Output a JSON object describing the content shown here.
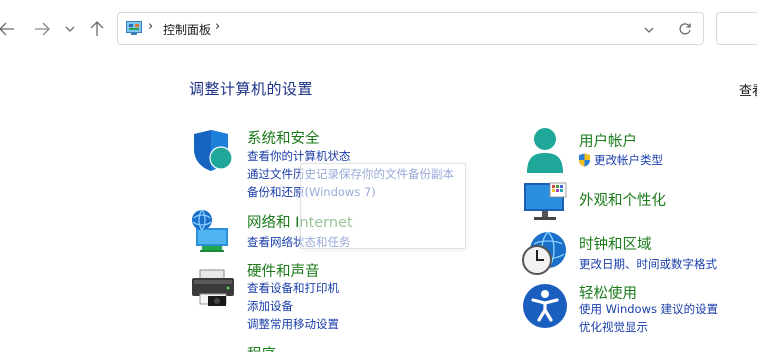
{
  "nav": {
    "back_icon": "arrow-left-icon",
    "forward_icon": "arrow-right-icon",
    "recent_icon": "chevron-down-icon",
    "up_icon": "arrow-up-icon"
  },
  "address": {
    "breadcrumb": "控制面板",
    "separator": "›",
    "dropdown_icon": "chevron-down-icon",
    "refresh_icon": "refresh-icon"
  },
  "main": {
    "title": "调整计算机的设置",
    "view_by": "查看",
    "categories": [
      {
        "icon": "shield-icon",
        "heading": "系统和安全",
        "links": [
          "查看你的计算机状态",
          "通过文件历史记录保存你的文件备份副本",
          "备份和还原(Windows 7)"
        ]
      },
      {
        "icon": "network-globe-icon",
        "heading": "网络和 Internet",
        "links": [
          "查看网络状态和任务"
        ]
      },
      {
        "icon": "printer-icon",
        "heading": "硬件和声音",
        "links": [
          "查看设备和打印机",
          "添加设备",
          "调整常用移动设置"
        ]
      },
      {
        "icon": "programs-icon",
        "heading": "程序",
        "links": []
      },
      {
        "icon": "user-icon",
        "heading": "用户帐户",
        "links": [
          "更改帐户类型"
        ]
      },
      {
        "icon": "monitor-icon",
        "heading": "外观和个性化",
        "links": []
      },
      {
        "icon": "clock-globe-icon",
        "heading": "时钟和区域",
        "links": [
          "更改日期、时间或数字格式"
        ]
      },
      {
        "icon": "accessibility-icon",
        "heading": "轻松使用",
        "links": [
          "使用 Windows 建议的设置",
          "优化视觉显示"
        ]
      }
    ]
  },
  "colors": {
    "title": "#1e3287",
    "heading": "#1a7a1a",
    "link": "#1a3ea8",
    "icon_blue": "#1565c0",
    "icon_teal": "#1fa89a"
  }
}
